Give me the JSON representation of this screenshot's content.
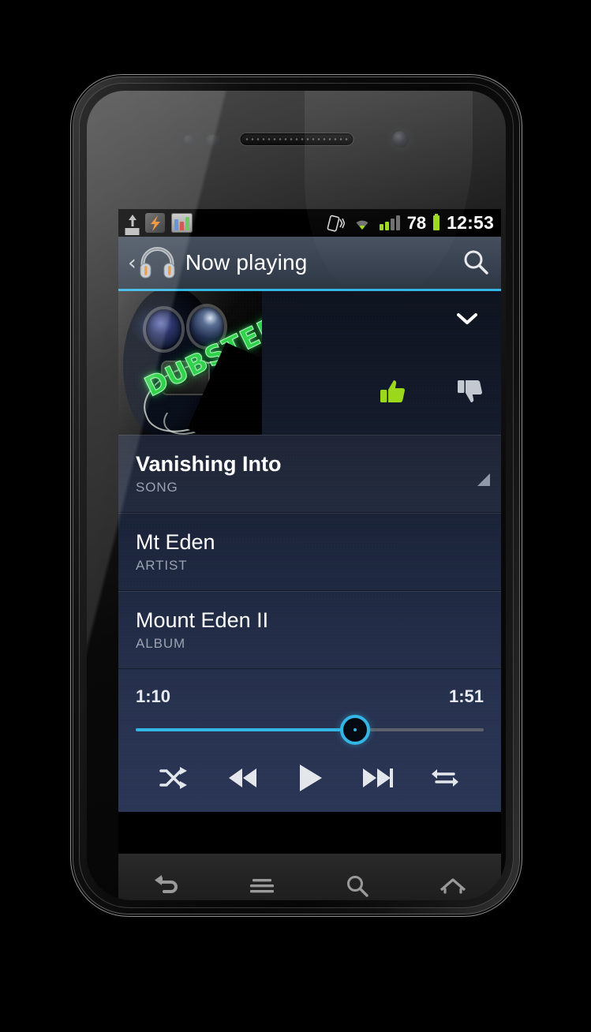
{
  "device": {
    "name": "android-phone",
    "model_style": "nexus-s"
  },
  "status_bar": {
    "icons_left": [
      "upload-icon",
      "bolt-icon",
      "monitor-chart-icon"
    ],
    "icons_right": [
      "vibrate-icon",
      "wifi-icon",
      "signal-icon"
    ],
    "signal_bars_total": 4,
    "signal_bars_active": 2,
    "battery_level": "78",
    "time": "12:53"
  },
  "action_bar": {
    "back_glyph": "‹",
    "logo": "google-play-music-headphones-icon",
    "title": "Now playing",
    "search_icon": "search-icon",
    "accent_color": "#33b5e5"
  },
  "now_playing": {
    "album_art": {
      "alt": "Gas mask with green DUBSTEP graffiti and spray can",
      "overlay_text": "DUBSTEP"
    },
    "expand_icon": "chevron-down-icon",
    "thumb_up": {
      "icon": "thumbs-up-icon",
      "state": "active",
      "color": "#9bd81c"
    },
    "thumb_down": {
      "icon": "thumbs-down-icon",
      "state": "inactive",
      "color": "#c4c9d1"
    },
    "rows": [
      {
        "title": "Vanishing Into",
        "label": "SONG",
        "highlighted": true
      },
      {
        "title": "Mt Eden",
        "label": "ARTIST",
        "highlighted": false
      },
      {
        "title": "Mount Eden II",
        "label": "ALBUM",
        "highlighted": false
      }
    ],
    "progress": {
      "elapsed": "1:10",
      "duration": "1:51",
      "percent": 63
    },
    "controls": [
      {
        "name": "shuffle-button",
        "icon": "shuffle-icon"
      },
      {
        "name": "previous-button",
        "icon": "skip-previous-icon"
      },
      {
        "name": "play-button",
        "icon": "play-icon"
      },
      {
        "name": "next-button",
        "icon": "skip-next-icon"
      },
      {
        "name": "repeat-button",
        "icon": "repeat-icon"
      }
    ]
  },
  "nav_bar": {
    "buttons": [
      {
        "name": "back-button",
        "icon": "back-arrow-icon"
      },
      {
        "name": "menu-button",
        "icon": "menu-lines-icon"
      },
      {
        "name": "search-button",
        "icon": "search-icon"
      },
      {
        "name": "home-button",
        "icon": "home-icon"
      }
    ]
  }
}
